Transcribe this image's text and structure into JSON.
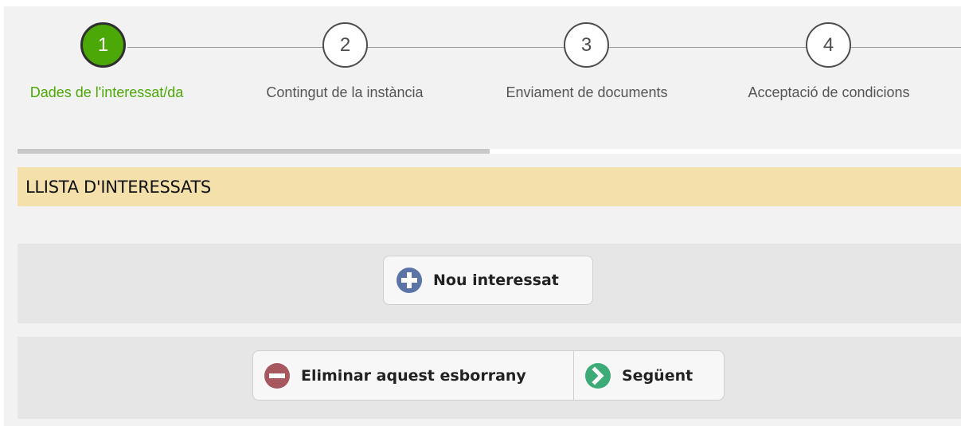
{
  "wizard": {
    "steps": [
      {
        "number": "1",
        "label": "Dades de l'interessat/da",
        "state": "active"
      },
      {
        "number": "2",
        "label": "Contingut de la instància",
        "state": "pending"
      },
      {
        "number": "3",
        "label": "Enviament de documents",
        "state": "pending"
      },
      {
        "number": "4",
        "label": "Acceptació de condicions",
        "state": "pending"
      }
    ],
    "progress": 0.5
  },
  "section": {
    "title": "LLISTA D'INTERESSATS"
  },
  "actions": {
    "add_label": "Nou interessat",
    "delete_label": "Eliminar aquest esborrany",
    "next_label": "Següent"
  },
  "colors": {
    "active_step": "#4ca806",
    "section_header_bg": "#f3e0ab",
    "plus_icon": "#5a74a8",
    "minus_icon": "#a6585e",
    "next_icon": "#3dab78"
  },
  "icons": [
    "plus-icon",
    "minus-icon",
    "chevron-right-icon"
  ]
}
